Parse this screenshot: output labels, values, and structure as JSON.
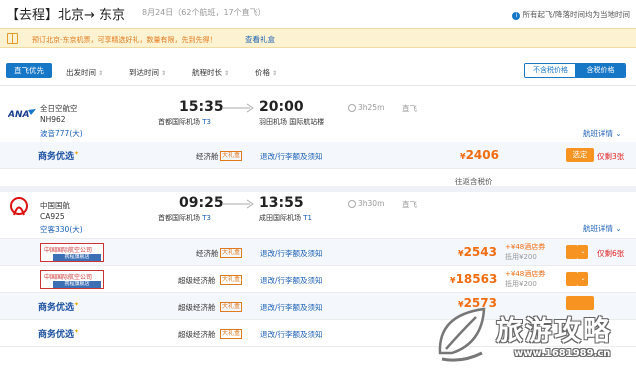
{
  "header": {
    "trip_label": "【去程】",
    "route": "北京→ 东京",
    "info": "8月24日（62个航班，17个直飞）",
    "tz_note": "所有起飞/降落时间均为当地时间",
    "tz_icon": "info-icon"
  },
  "promo": {
    "text": "预订北京-东京机票，可享精选好礼，数量有限，先到先得！",
    "link": "查看礼盒",
    "icon": "gift-icon"
  },
  "sortbar": {
    "direct_first": "直飞优先",
    "dep_time": "出发时间",
    "arr_time": "到达时间",
    "duration": "航程时长",
    "price": "价格",
    "no_tax": "不含税价格",
    "with_tax": "含税价格"
  },
  "flights": [
    {
      "airline": "全日空航空",
      "flight_no": "NH962",
      "plane": "波音777(大)",
      "dep_time": "15:35",
      "dep_airport": "首都国际机场",
      "dep_terminal": "T3",
      "arr_time": "20:00",
      "arr_airport": "羽田机场 国际航站楼",
      "arr_terminal": "",
      "duration": "3h25m",
      "stop": "直飞",
      "detail": "航班详情",
      "fares": [
        {
          "brand": "商务优选",
          "cabin": "经济舱",
          "gift": "大礼盒",
          "refund": "退改/行李额及须知",
          "price": "2406",
          "book": "选定",
          "left": "仅剩3张"
        }
      ],
      "tax_note": "往返含税价"
    },
    {
      "airline": "中国国航",
      "flight_no": "CA925",
      "plane": "空客330(大)",
      "dep_time": "09:25",
      "dep_airport": "首都国际机场",
      "dep_terminal": "T3",
      "arr_time": "13:55",
      "arr_airport": "成田国际机场",
      "arr_terminal": "T1",
      "duration": "3h30m",
      "stop": "直飞",
      "detail": "航班详情",
      "fares": [
        {
          "brand_stamp": "中国国际航空公司",
          "stamp_sub": "携程旗舰店",
          "cabin": "经济舱",
          "gift": "大礼盒",
          "refund": "退改/行李额及须知",
          "price": "2543",
          "hotel": "+¥48酒店券",
          "hotel_sub": "抵用¥200",
          "left": "仅剩6张"
        },
        {
          "brand_stamp": "中国国际航空公司",
          "stamp_sub": "携程旗舰店",
          "cabin": "超级经济舱",
          "gift": "大礼盒",
          "refund": "退改/行李额及须知",
          "price": "18563",
          "hotel": "+¥48酒店券",
          "hotel_sub": "抵用¥200"
        },
        {
          "brand": "商务优选",
          "cabin": "超级经济舱",
          "gift": "大礼盒",
          "refund": "退改/行李额及须知",
          "price": "2573"
        },
        {
          "brand": "商务优选",
          "cabin": "超级经济舱",
          "gift": "大礼盒",
          "refund": "退改/行李额及须知"
        }
      ]
    }
  ],
  "watermark": {
    "title": "旅游攻略",
    "url": "www.1681989.cn"
  },
  "colors": {
    "accent": "#1677c7",
    "price": "#f06d13",
    "book": "#f79321",
    "warn": "#e02020"
  }
}
